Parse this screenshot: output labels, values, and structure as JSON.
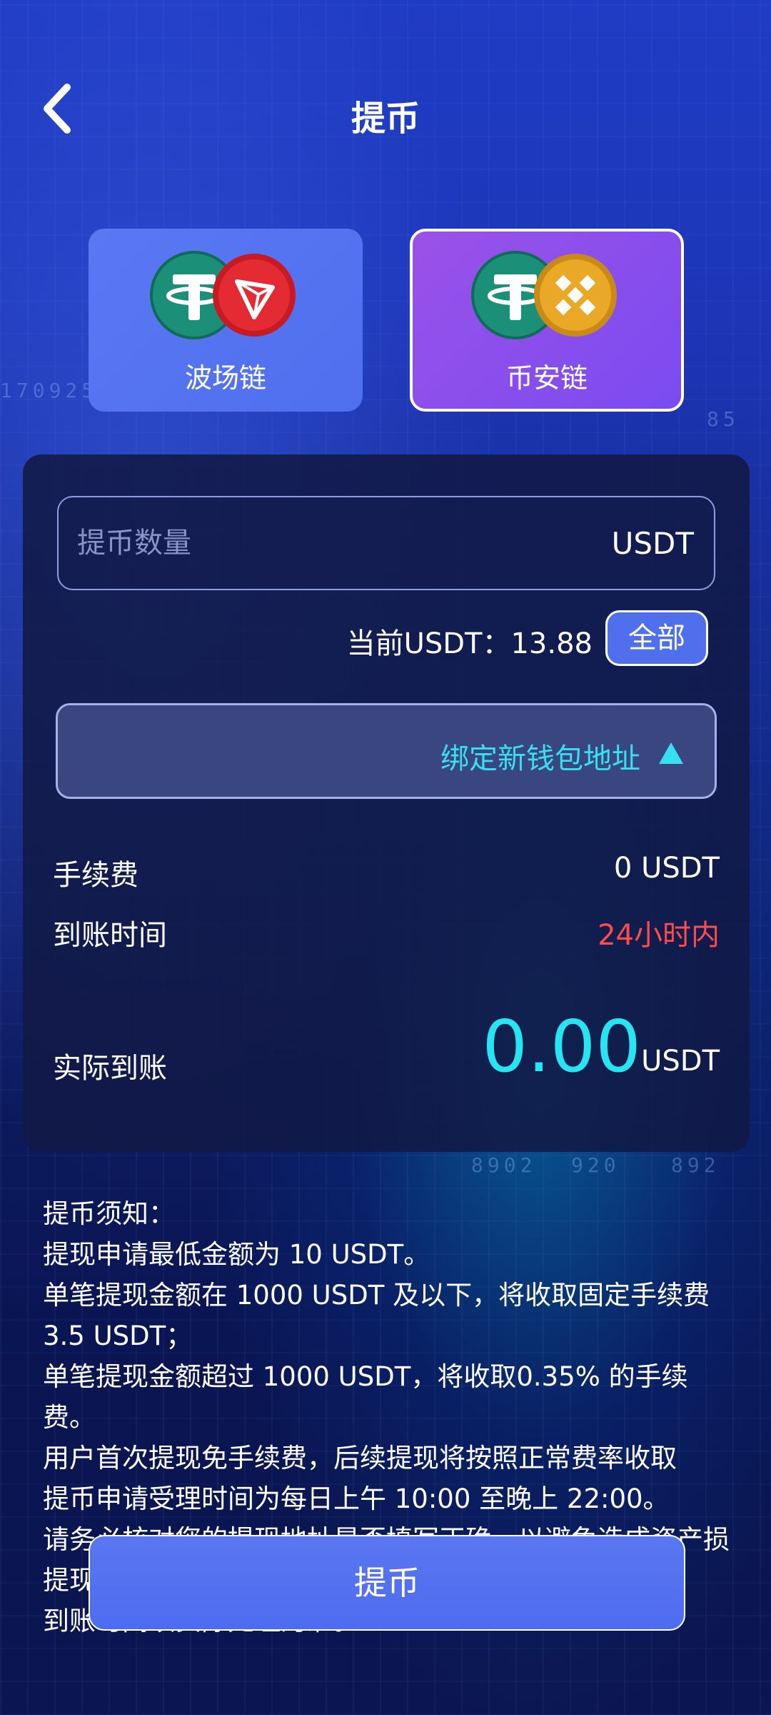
{
  "header": {
    "title": "提币",
    "back_icon": "chevron-left-icon"
  },
  "chain_tabs": [
    {
      "label": "波场链",
      "icons": [
        "usdt-tether-icon",
        "tron-icon"
      ],
      "selected": false
    },
    {
      "label": "币安链",
      "icons": [
        "usdt-tether-icon",
        "bnb-icon"
      ],
      "selected": true
    }
  ],
  "amount": {
    "placeholder": "提币数量",
    "unit": "USDT"
  },
  "balance": {
    "text": "当前USDT：13.88",
    "all_button": "全部"
  },
  "wallet": {
    "label": "绑定新钱包地址",
    "icon": "triangle-up-icon"
  },
  "fee": {
    "label": "手续费",
    "value": "0 USDT"
  },
  "arrival_time": {
    "label": "到账时间",
    "value": "24小时内"
  },
  "actual_received": {
    "label": "实际到账",
    "value": "0.00",
    "unit": "USDT"
  },
  "notes": [
    "提币须知：",
    "提现申请最低金额为 10 USDT。",
    "单笔提现金额在 1000 USDT 及以下，将收取固定手续费 3.5 USDT；",
    "单笔提现金额超过 1000 USDT，将收取0.35% 的手续费。",
    "用户首次提现免手续费，后续提现将按照正常费率收取",
    "提币申请受理时间为每日上午 10:00 至晚上 22:00。",
    "请务必核对您的提现地址是否填写正确，以避免造成资产损",
    "提现",
    "到账时间以实际处理为准。"
  ],
  "submit": {
    "label": "提币"
  },
  "colors": {
    "accent_blue": "#4f6fef",
    "accent_purple": "#8a4ff0",
    "cyan": "#27e4f3",
    "warning_red": "#ff4b4b",
    "usdt_green": "#1f9e85",
    "tron_red": "#e4222c",
    "bnb_gold": "#e9a826"
  },
  "background_digits": [
    "1709250",
    "85",
    "8902",
    "920",
    "892"
  ]
}
